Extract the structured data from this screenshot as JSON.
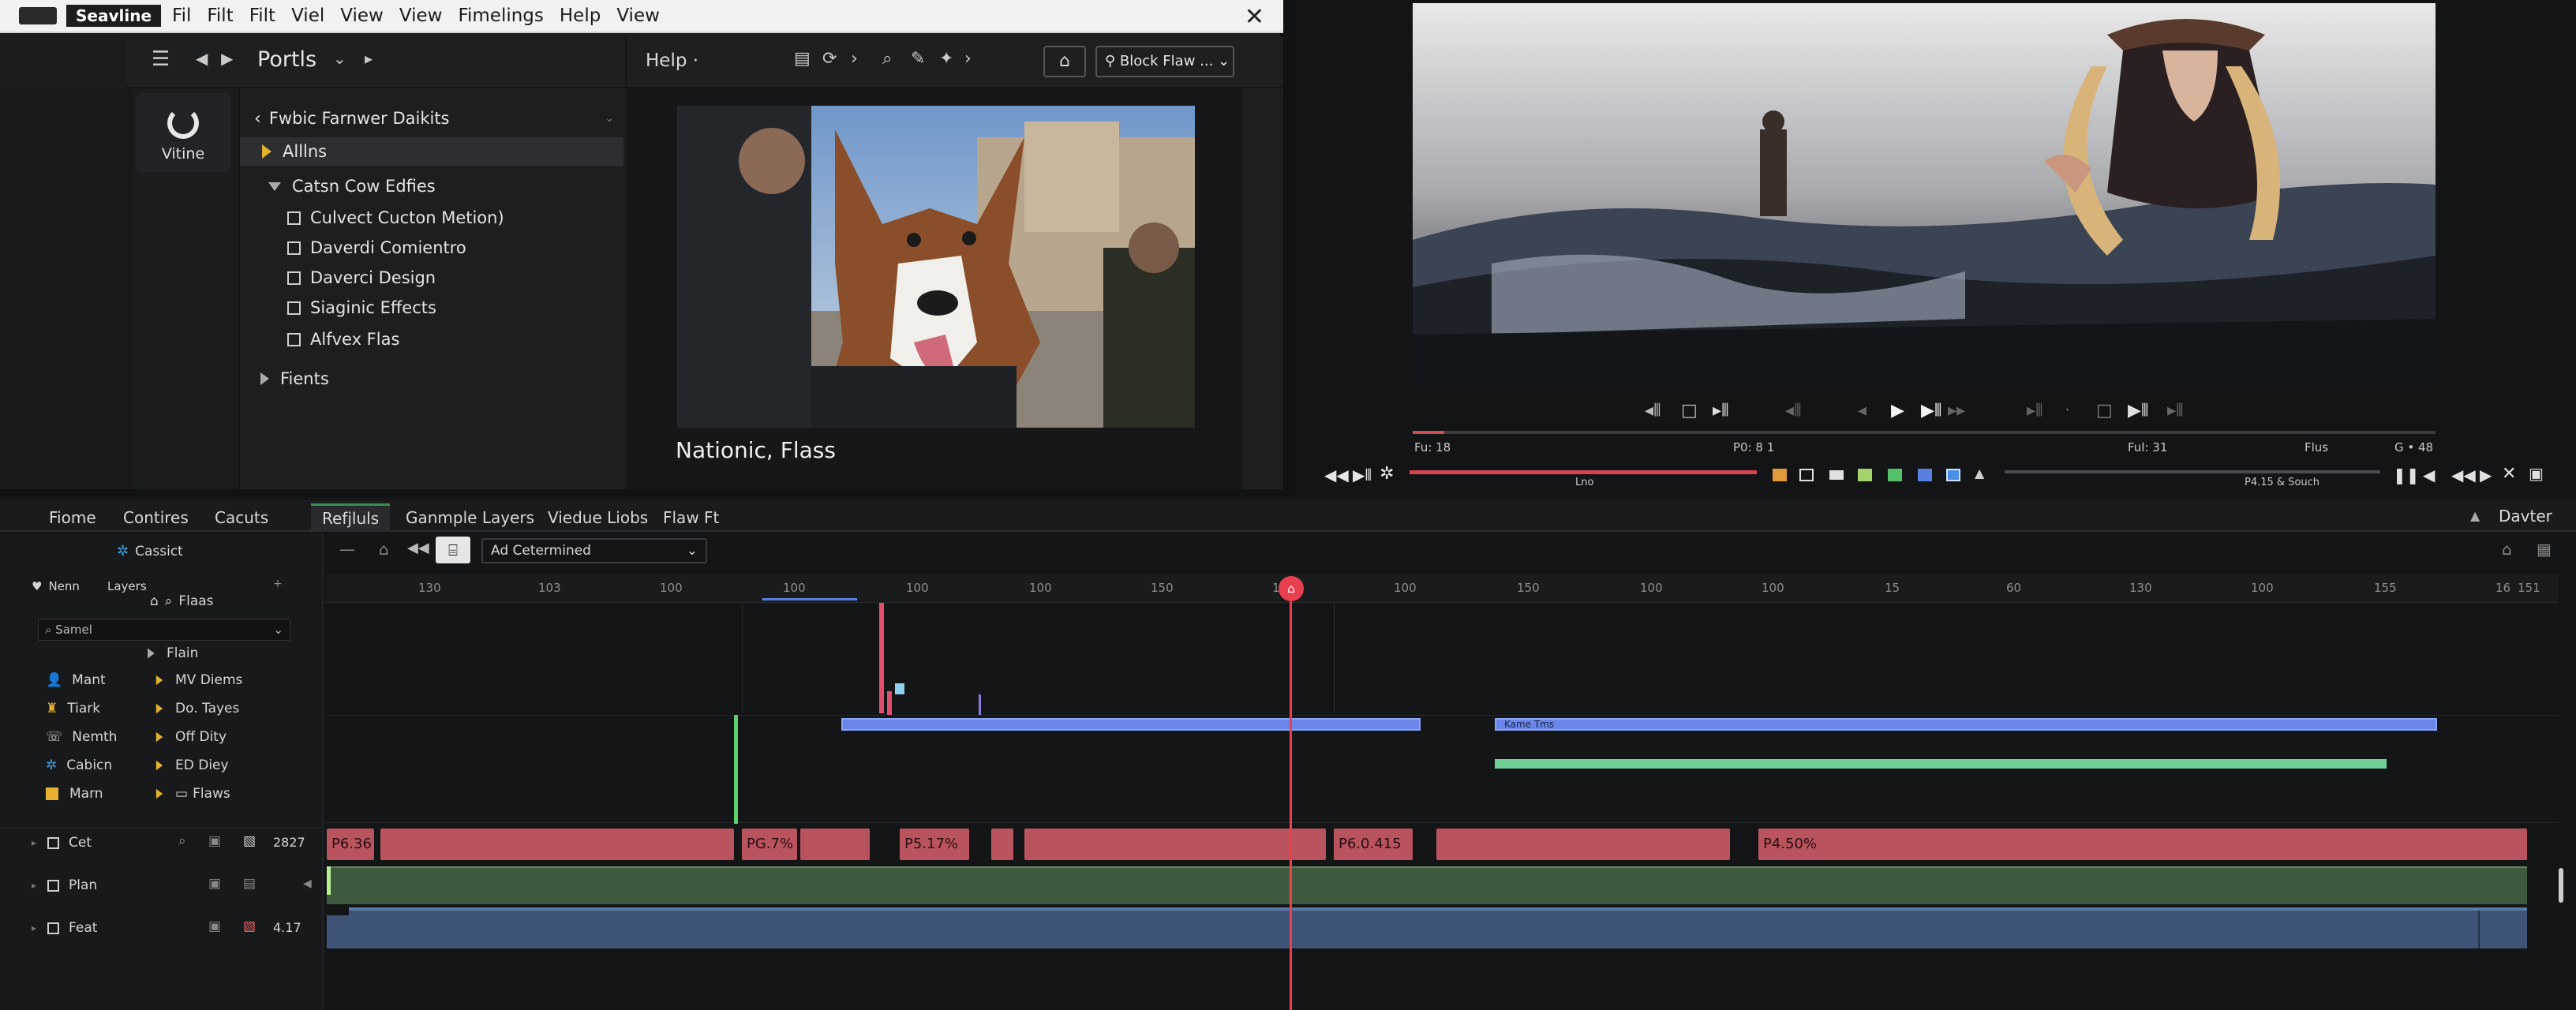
{
  "titlebar": {
    "app_name": "Seavline",
    "menus": [
      "Fil",
      "Filt",
      "Filt",
      "Viel",
      "View",
      "View",
      "Fimelings",
      "Help",
      "View"
    ],
    "close_label": "✕"
  },
  "toolbar": {
    "section_label": "Portls",
    "help_label": "Help ·",
    "search_button_label": "Block Flaw ... ⌄"
  },
  "side_icon": {
    "label": "Vitine"
  },
  "tree": {
    "header": "Fwbic Farnwer Daikits",
    "items": [
      {
        "label": "Alllns"
      },
      {
        "label": "Catsn Cow Edfies"
      },
      {
        "label": "Culvect Cucton Metion)"
      },
      {
        "label": "Daverdi Comientro"
      },
      {
        "label": "Daverci Design"
      },
      {
        "label": "Siaginic Effects"
      },
      {
        "label": "Alfvex Flas"
      },
      {
        "label": "Fients"
      }
    ]
  },
  "preview": {
    "caption": "Nationic, Flass"
  },
  "viewer": {
    "stats": [
      "Fu: 18",
      "P0: 8 1",
      "Ful: 31",
      "Flus",
      "G • 48"
    ],
    "bottom_labels": [
      "Lno",
      "P4.15 & Souch"
    ]
  },
  "tabs": [
    "Fiome",
    "Contires",
    "Cacuts",
    "Refjluls",
    "Ganmple Layers",
    "Viedue Liobs",
    "Flaw Ft"
  ],
  "tabs_right": "Davter",
  "timeline_toolbar": {
    "cassic": "Cassict",
    "dropdown": "Ad Cetermined"
  },
  "layers_panel": {
    "headers": [
      "Nenn",
      "Layers",
      "Flaas"
    ],
    "search_placeholder": "Samel",
    "rows": [
      {
        "name": "",
        "value": "Flain"
      },
      {
        "name": "Mant",
        "value": "MV Diems"
      },
      {
        "name": "Tiark",
        "value": "Do. Tayes"
      },
      {
        "name": "Nemth",
        "value": "Off Dity"
      },
      {
        "name": "Cabicn",
        "value": "ED Diey"
      },
      {
        "name": "Marn",
        "value": "Flaws"
      }
    ]
  },
  "tracks": [
    {
      "name": "Cet",
      "value": "2827"
    },
    {
      "name": "Plan",
      "value": ""
    },
    {
      "name": "Feat",
      "value": "4.17"
    }
  ],
  "ruler_ticks": [
    "130",
    "103",
    "100",
    "100",
    "100",
    "100",
    "150",
    "100",
    "100",
    "150",
    "100",
    "100",
    "15",
    "60",
    "130",
    "100",
    "155",
    "16",
    "151"
  ],
  "clips": [
    "P6.36",
    "",
    "PG.7%",
    "",
    "P5.17%",
    "",
    "",
    "P6.0.415",
    "",
    "P4.50%"
  ],
  "blue_track_label": "Kame Tms",
  "colors": {
    "accent_red": "#e8404f",
    "clip_red": "#b9545f",
    "track_green": "#3d5a3f",
    "track_blue": "#3d5477",
    "bar_blue": "#6a86e8"
  }
}
